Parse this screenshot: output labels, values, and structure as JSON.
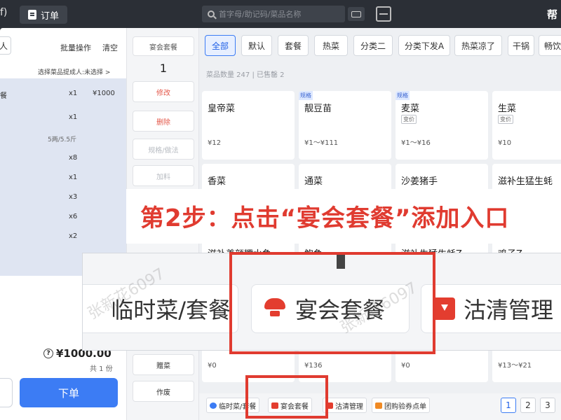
{
  "topbar": {
    "back_text": "f)",
    "order_tab": "订单",
    "search_placeholder": "首字母/助记码/菜品名称",
    "help_text": "帮"
  },
  "left": {
    "top_btn": "人",
    "batch": "批量操作",
    "clear": "清空",
    "person": "选择菜品提成人:未选择 >",
    "rows": [
      {
        "name": "餐",
        "qty": "x1",
        "price": "¥1000",
        "spec": ""
      },
      {
        "name": "",
        "qty": "x1",
        "price": "",
        "spec": ""
      },
      {
        "name": "",
        "qty": "",
        "price": "",
        "spec": "5两/5.5斤"
      },
      {
        "name": "",
        "qty": "x8",
        "price": "",
        "spec": ""
      },
      {
        "name": "",
        "qty": "x1",
        "price": "",
        "spec": ""
      },
      {
        "name": "",
        "qty": "x3",
        "price": "",
        "spec": ""
      },
      {
        "name": "",
        "qty": "x6",
        "price": "",
        "spec": ""
      },
      {
        "name": "",
        "qty": "x2",
        "price": "",
        "spec": ""
      }
    ],
    "total": "¥1000.00",
    "count": "共 1 份",
    "submit": "下单"
  },
  "mid": {
    "label": "宴会套餐",
    "qty": "1",
    "edit": "修改",
    "delete": "删除",
    "spec": "规格/做法",
    "add": "加料",
    "gift": "赠菜",
    "void": "作废"
  },
  "categories": [
    "全部",
    "默认",
    "套餐",
    "热菜",
    "分类二",
    "分类下发A",
    "热菜凉了",
    "干锅",
    "畅饮"
  ],
  "dish_count": "菜品数量 247 | 已售罄 2",
  "dishes": [
    {
      "name": "皇帝菜",
      "price": "¥12",
      "spec_tag": "",
      "var_tag": ""
    },
    {
      "name": "靓豆苗",
      "price": "¥1～¥111",
      "spec_tag": "规格",
      "var_tag": ""
    },
    {
      "name": "麦菜",
      "price": "¥1～¥16",
      "spec_tag": "规格",
      "var_tag": "变价"
    },
    {
      "name": "生菜",
      "price": "¥10",
      "spec_tag": "",
      "var_tag": "变价"
    },
    {
      "name": "香菜",
      "price": "",
      "spec_tag": "",
      "var_tag": ""
    },
    {
      "name": "通菜",
      "price": "",
      "spec_tag": "",
      "var_tag": ""
    },
    {
      "name": "沙姜猪手",
      "price": "",
      "spec_tag": "",
      "var_tag": ""
    },
    {
      "name": "滋补生猛生蚝",
      "price": "",
      "spec_tag": "",
      "var_tag": ""
    },
    {
      "name": "滋补养颜糯水鱼",
      "price": "",
      "spec_tag": "",
      "var_tag": ""
    },
    {
      "name": "鲍鱼",
      "price": "",
      "spec_tag": "",
      "var_tag": ""
    },
    {
      "name": "滋补生猛生蚝Z",
      "price": "",
      "spec_tag": "",
      "var_tag": ""
    },
    {
      "name": "鸡子Z",
      "price": "",
      "spec_tag": "",
      "var_tag": ""
    },
    {
      "name": "",
      "price": "¥0",
      "spec_tag": "",
      "var_tag": ""
    },
    {
      "name": "",
      "price": "¥136",
      "spec_tag": "",
      "var_tag": ""
    },
    {
      "name": "",
      "price": "¥0",
      "spec_tag": "",
      "var_tag": ""
    },
    {
      "name": "",
      "price": "¥13～¥21",
      "spec_tag": "",
      "var_tag": ""
    }
  ],
  "bottom": {
    "temp": "临时菜/套餐",
    "banquet": "宴会套餐",
    "clean": "沽清管理",
    "group": "团购验券点单",
    "pages": [
      "1",
      "2",
      "3"
    ]
  },
  "annotation": {
    "text": "第2步：点击“宴会套餐”添加入口",
    "zoom_temp": "临时菜/套餐",
    "zoom_banquet": "宴会套餐",
    "zoom_clean": "沽清管理",
    "watermark": "张新花6097"
  },
  "colors": {
    "accent": "#3c7cf4",
    "annotation_red": "#e03b30"
  }
}
